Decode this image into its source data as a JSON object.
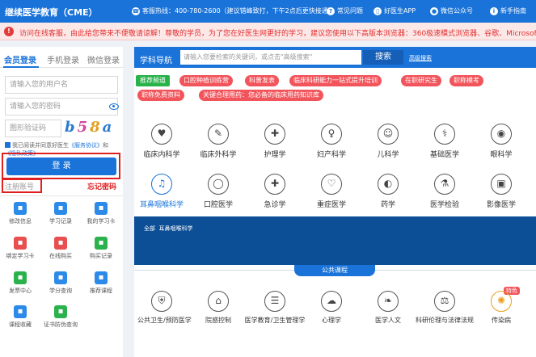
{
  "topbar": {
    "title": "继续医学教育（CME）",
    "hotline": "客服热线：400-780-2600（建议错峰致打，下午2点后更快接通）",
    "faq": "常见问题",
    "app": "好医生APP",
    "wechat": "微信公众号",
    "guide": "新手指南"
  },
  "notice": {
    "text": "访问在线客服，由此给您带来不便敬请谅解！尊敬的学员，为了您在好医生网更好的学习，建议您使用以下高版本浏览器：360极速模式浏览器、谷歌、Microsoft Edge"
  },
  "login": {
    "tabs": [
      "会员登录",
      "手机登录",
      "微信登录"
    ],
    "username_placeholder": "请输入您的用户名",
    "password_placeholder": "请输入您的密码",
    "captcha_placeholder": "图形验证码",
    "captcha_text": "b58a",
    "agree_prefix": "我已阅读并同意好医生",
    "service_agreement": "《服务协议》",
    "and": "和",
    "privacy_policy": "《隐私政策》",
    "login_button": "登 录",
    "register": "注册账号",
    "forgot": "忘记密码"
  },
  "quick_links": [
    {
      "label": "修改信息",
      "icon": "edit-icon",
      "color": "#2c8ae8"
    },
    {
      "label": "学习记录",
      "icon": "record-icon",
      "color": "#2c8ae8"
    },
    {
      "label": "我的学习卡",
      "icon": "card-icon",
      "color": "#2c8ae8"
    },
    {
      "label": "绑定学习卡",
      "icon": "bind-card-icon",
      "color": "#e85050"
    },
    {
      "label": "在线购买",
      "icon": "buy-icon",
      "color": "#e85050"
    },
    {
      "label": "购买记录",
      "icon": "cart-icon",
      "color": "#2bb24c"
    },
    {
      "label": "发票中心",
      "icon": "invoice-icon",
      "color": "#2bb24c"
    },
    {
      "label": "学分查询",
      "icon": "credit-icon",
      "color": "#2c8ae8"
    },
    {
      "label": "推荐课程",
      "icon": "course-icon",
      "color": "#2c8ae8"
    },
    {
      "label": "课程收藏",
      "icon": "favorite-icon",
      "color": "#2c8ae8"
    },
    {
      "label": "证书防伪查询",
      "icon": "certificate-icon",
      "color": "#2bb24c"
    }
  ],
  "search": {
    "nav_label": "学科导航",
    "placeholder": "请输入您要检索的关键词，或点击\"高级搜索\"",
    "button": "搜索",
    "advanced": "高级搜索"
  },
  "tags": {
    "recommended": "推荐频道",
    "items": [
      "口腔种植训练营",
      "科普发表",
      "临床科研能力一站式提升培训",
      "在职研究生",
      "职称模考",
      "职称免费资料",
      "关键合理用药：您必备的临床用药知识库"
    ]
  },
  "subjects": [
    {
      "label": "临床内科学",
      "icon": "internal-medicine-icon",
      "glyph": "♥"
    },
    {
      "label": "临床外科学",
      "icon": "surgery-icon",
      "glyph": "✎"
    },
    {
      "label": "护理学",
      "icon": "nursing-icon",
      "glyph": "✚"
    },
    {
      "label": "妇产科学",
      "icon": "obstetrics-icon",
      "glyph": "♀"
    },
    {
      "label": "儿科学",
      "icon": "pediatrics-icon",
      "glyph": "☺"
    },
    {
      "label": "基础医学",
      "icon": "stethoscope-icon",
      "glyph": "⚕"
    },
    {
      "label": "眼科学",
      "icon": "eye-icon",
      "glyph": "◉"
    },
    {
      "label": "耳鼻咽喉科学",
      "icon": "ear-icon",
      "glyph": "♫"
    },
    {
      "label": "口腔医学",
      "icon": "tooth-icon",
      "glyph": "◯"
    },
    {
      "label": "急诊学",
      "icon": "ambulance-icon",
      "glyph": "✚"
    },
    {
      "label": "重症医学",
      "icon": "monitor-icon",
      "glyph": "♡"
    },
    {
      "label": "药学",
      "icon": "pill-icon",
      "glyph": "◐"
    },
    {
      "label": "医学检验",
      "icon": "microscope-icon",
      "glyph": "⚗"
    },
    {
      "label": "影像医学",
      "icon": "imaging-icon",
      "glyph": "▣"
    }
  ],
  "breadcrumb": {
    "all": "全部",
    "current": "耳鼻咽喉科学"
  },
  "public_courses": {
    "header": "公共课程",
    "hot_badge": "特色",
    "items": [
      {
        "label": "公共卫生/预防医学",
        "icon": "shield-icon",
        "glyph": "⛨"
      },
      {
        "label": "院感控制",
        "icon": "hospital-icon",
        "glyph": "⌂"
      },
      {
        "label": "医学教育/卫生管理学",
        "icon": "education-icon",
        "glyph": "☰"
      },
      {
        "label": "心理学",
        "icon": "psychology-icon",
        "glyph": "☁"
      },
      {
        "label": "医学人文",
        "icon": "humanities-icon",
        "glyph": "❧"
      },
      {
        "label": "科研伦理与法律法规",
        "icon": "scales-icon",
        "glyph": "⚖"
      },
      {
        "label": "传染病",
        "icon": "virus-icon",
        "glyph": "✺"
      }
    ]
  },
  "colors": {
    "primary": "#1a73d9",
    "dark_panel": "#0c4f97",
    "tag_red": "#f2545b",
    "tag_green": "#27b34a",
    "highlight_red": "#e02020"
  }
}
